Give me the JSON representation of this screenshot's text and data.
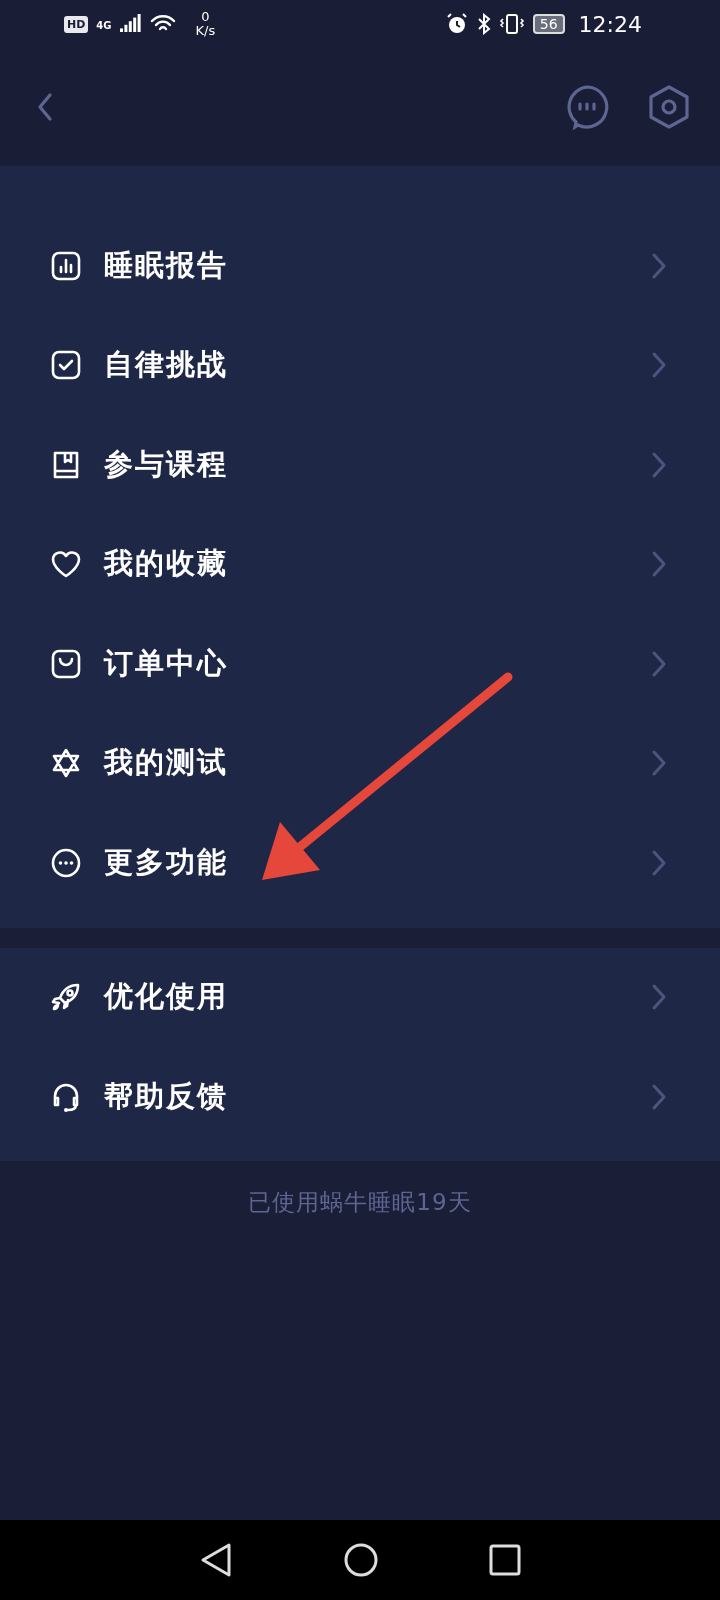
{
  "status_bar": {
    "hd": "HD",
    "network": "4G",
    "speed_value": "0",
    "speed_unit": "K/s",
    "battery": "56",
    "time": "12:24"
  },
  "menu_groups": [
    {
      "items": [
        {
          "kind": "report",
          "label": "睡眠报告"
        },
        {
          "kind": "check",
          "label": "自律挑战"
        },
        {
          "kind": "book",
          "label": "参与课程"
        },
        {
          "kind": "heart",
          "label": "我的收藏"
        },
        {
          "kind": "bag",
          "label": "订单中心"
        },
        {
          "kind": "star",
          "label": "我的测试"
        },
        {
          "kind": "more",
          "label": "更多功能"
        }
      ]
    },
    {
      "items": [
        {
          "kind": "rocket",
          "label": "优化使用"
        },
        {
          "kind": "headset",
          "label": "帮助反馈"
        }
      ]
    }
  ],
  "footer": "已使用蜗牛睡眠19天"
}
